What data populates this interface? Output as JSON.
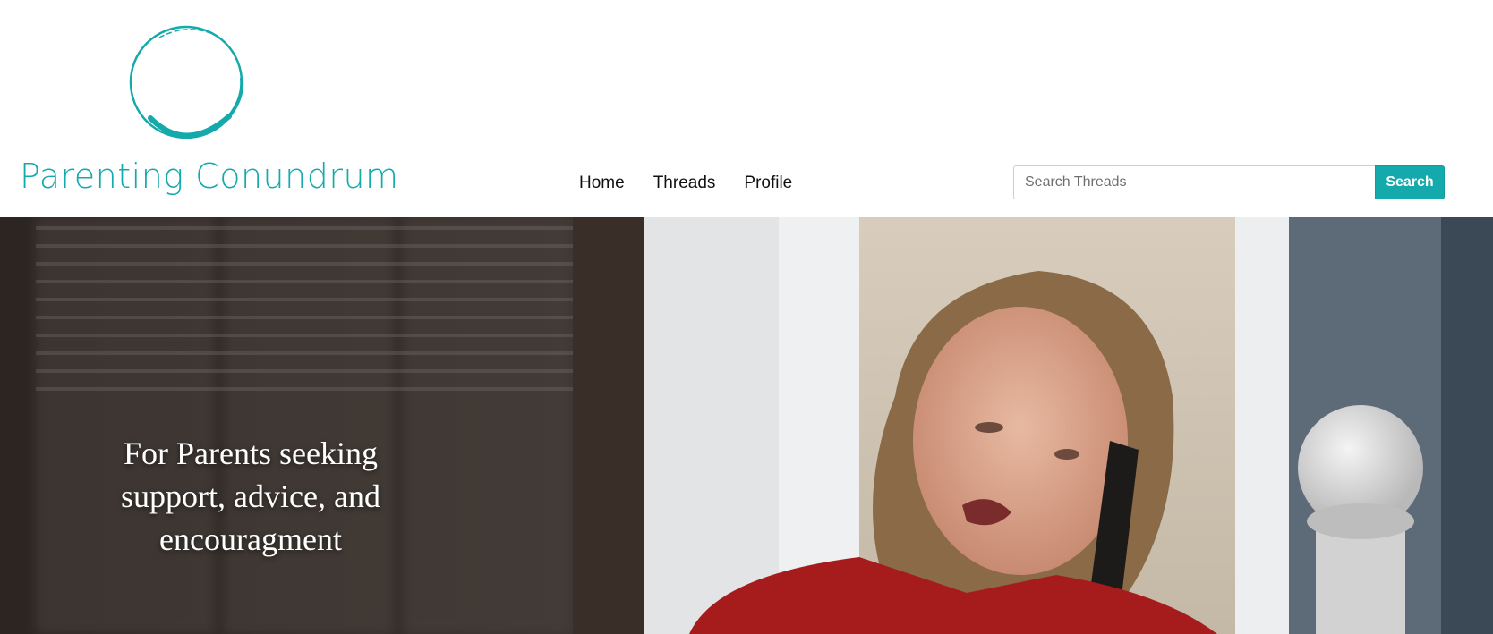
{
  "brand": {
    "name": "Parenting Conundrum",
    "accent_color": "#14a9ab",
    "logo_icon": "ring-logo-icon"
  },
  "nav": {
    "items": [
      {
        "label": "Home"
      },
      {
        "label": "Threads"
      },
      {
        "label": "Profile"
      }
    ]
  },
  "search": {
    "placeholder": "Search Threads",
    "value": "",
    "button_label": "Search"
  },
  "hero": {
    "tagline": "For Parents seeking support, advice, and encouragment",
    "image": "photo-woman-on-phone"
  }
}
